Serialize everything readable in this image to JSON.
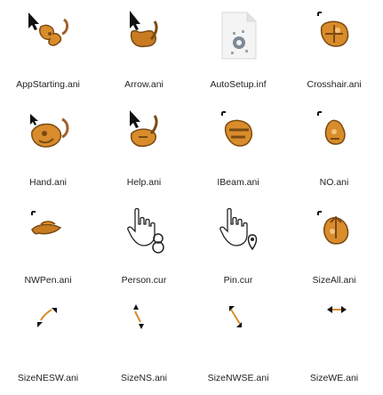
{
  "window": {
    "title": ""
  },
  "files": [
    {
      "name": "AppStarting.ani",
      "icon": "busy-arrow-cursor-icon"
    },
    {
      "name": "Arrow.ani",
      "icon": "arrow-cursor-icon"
    },
    {
      "name": "AutoSetup.inf",
      "icon": "setup-file-icon"
    },
    {
      "name": "Crosshair.ani",
      "icon": "crosshair-cursor-icon"
    },
    {
      "name": "Hand.ani",
      "icon": "hand-cursor-icon"
    },
    {
      "name": "Help.ani",
      "icon": "help-cursor-icon"
    },
    {
      "name": "IBeam.ani",
      "icon": "ibeam-cursor-icon"
    },
    {
      "name": "NO.ani",
      "icon": "no-cursor-icon"
    },
    {
      "name": "NWPen.ani",
      "icon": "pen-cursor-icon"
    },
    {
      "name": "Person.cur",
      "icon": "person-cursor-icon"
    },
    {
      "name": "Pin.cur",
      "icon": "pin-cursor-icon"
    },
    {
      "name": "SizeAll.ani",
      "icon": "size-all-cursor-icon"
    },
    {
      "name": "SizeNESW.ani",
      "icon": "size-nesw-cursor-icon"
    },
    {
      "name": "SizeNS.ani",
      "icon": "size-ns-cursor-icon"
    },
    {
      "name": "SizeNWSE.ani",
      "icon": "size-nwse-cursor-icon"
    },
    {
      "name": "SizeWE.ani",
      "icon": "size-we-cursor-icon"
    }
  ],
  "colors": {
    "mascot_orange": "#d98c2b",
    "mascot_dark": "#7a4a12",
    "cursor_black": "#111111",
    "file_gray": "#e9e9e9"
  }
}
